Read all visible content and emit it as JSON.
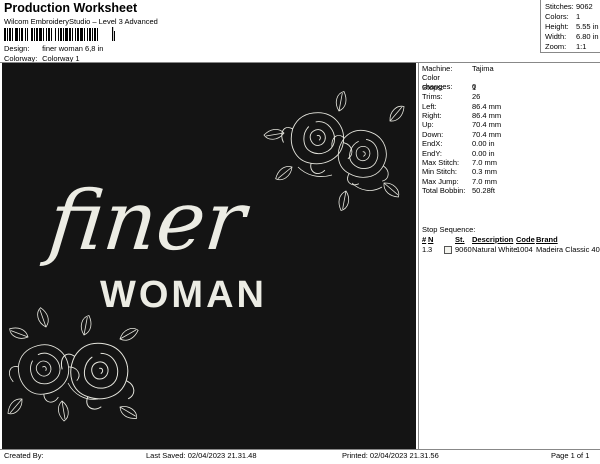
{
  "header": {
    "title": "Production Worksheet",
    "app": "Wilcom EmbroideryStudio – Level 3 Advanced",
    "design_label": "Design:",
    "design_value": "finer woman 6,8 in",
    "colorway_label": "Colorway:",
    "colorway_value": "Colorway 1"
  },
  "stats": [
    {
      "k": "Stitches:",
      "v": "9062"
    },
    {
      "k": "Colors:",
      "v": "1"
    },
    {
      "k": "Height:",
      "v": "5.55 in"
    },
    {
      "k": "Width:",
      "v": "6.80 in"
    },
    {
      "k": "Zoom:",
      "v": "1:1"
    }
  ],
  "design": {
    "text_script": "finer",
    "text_block": "WOMAN",
    "background": "#141414",
    "thread_color": "#ecece4"
  },
  "properties": [
    {
      "k": "Machine:",
      "v": "Tajima"
    },
    {
      "k": "Color changes:",
      "v": "0"
    },
    {
      "k": "Stops:",
      "v": "1"
    },
    {
      "k": "Trims:",
      "v": "26"
    },
    {
      "k": "Left:",
      "v": "86.4 mm"
    },
    {
      "k": "Right:",
      "v": "86.4 mm"
    },
    {
      "k": "Up:",
      "v": "70.4 mm"
    },
    {
      "k": "Down:",
      "v": "70.4 mm"
    },
    {
      "k": "EndX:",
      "v": "0.00 in"
    },
    {
      "k": "EndY:",
      "v": "0.00 in"
    },
    {
      "k": "Max Stitch:",
      "v": "7.0 mm"
    },
    {
      "k": "Min Stitch:",
      "v": "0.3 mm"
    },
    {
      "k": "Max Jump:",
      "v": "7.0 mm"
    },
    {
      "k": "Total Bobbin:",
      "v": "50.28ft"
    }
  ],
  "stop_sequence": {
    "title": "Stop Sequence:",
    "headers": {
      "num": "#",
      "n": "N",
      "st": "St.",
      "description": "Description",
      "code": "Code",
      "brand": "Brand"
    },
    "rows": [
      {
        "num": "1.",
        "n": "3",
        "st": "9060",
        "description": "Natural White",
        "code": "1004",
        "brand": "Madeira Classic 40"
      }
    ]
  },
  "footer": {
    "created": "Created By:",
    "last_saved": "Last Saved:  02/04/2023 21.31.48",
    "printed": "Printed:  02/04/2023 21.31.56",
    "page": "Page 1 of 1"
  }
}
